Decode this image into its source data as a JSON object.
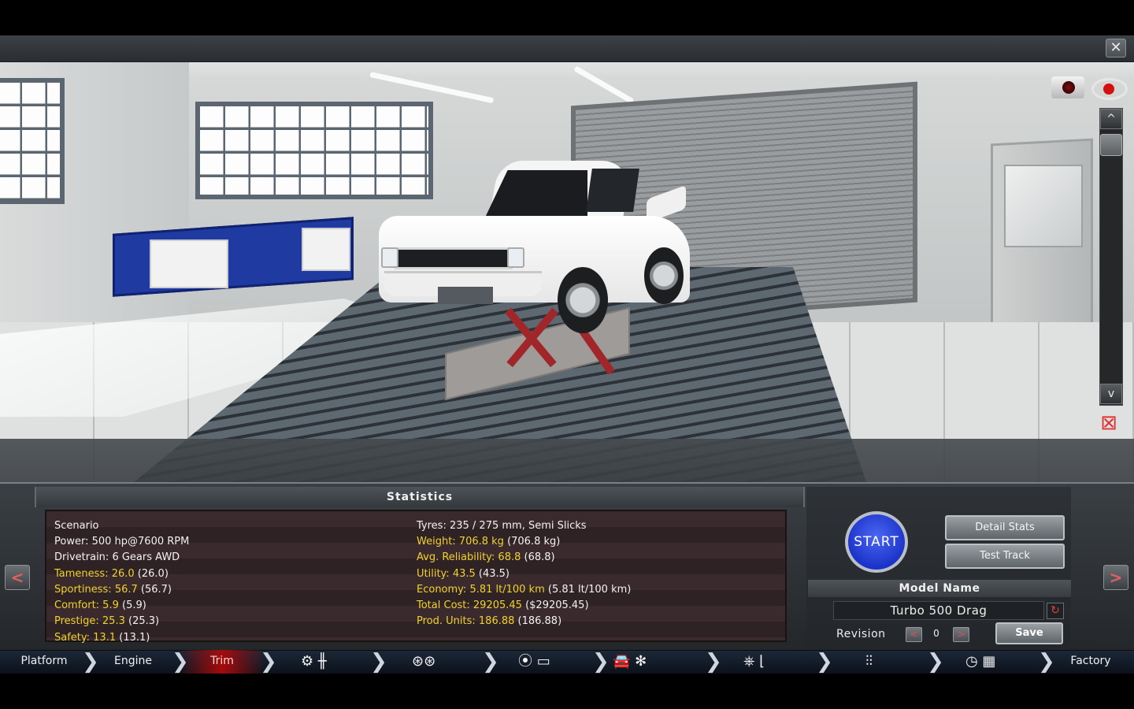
{
  "window": {
    "close_glyph": "✕"
  },
  "viewport": {
    "camera_icon": "camera-icon",
    "eye_icon": "eye-icon",
    "scroll_up": "^",
    "scroll_down": "v",
    "reset_glyph": "⊠"
  },
  "statistics": {
    "title": "Statistics",
    "left": [
      {
        "label": "Scenario",
        "value": "",
        "highlight": false
      },
      {
        "label": "Power:",
        "value": "500 hp@7600 RPM",
        "highlight": false
      },
      {
        "label": "Drivetrain:",
        "value": "6 Gears AWD",
        "highlight": false
      },
      {
        "label": "Tameness:",
        "value": "26.0",
        "paren": "(26.0)",
        "highlight": true
      },
      {
        "label": "Sportiness:",
        "value": "56.7",
        "paren": "(56.7)",
        "highlight": true
      },
      {
        "label": "Comfort:",
        "value": "5.9",
        "paren": "(5.9)",
        "highlight": true
      },
      {
        "label": "Prestige:",
        "value": "25.3",
        "paren": "(25.3)",
        "highlight": true
      },
      {
        "label": "Safety:",
        "value": "13.1",
        "paren": "(13.1)",
        "highlight": true
      }
    ],
    "right": [
      {
        "label": "Tyres:",
        "value": "235 / 275 mm, Semi Slicks",
        "highlight": false
      },
      {
        "label": "Weight:",
        "value": "706.8 kg",
        "paren": "(706.8 kg)",
        "highlight": true
      },
      {
        "label": "Avg. Reliability:",
        "value": "68.8",
        "paren": "(68.8)",
        "highlight": true
      },
      {
        "label": "Utility:",
        "value": "43.5",
        "paren": "(43.5)",
        "highlight": true
      },
      {
        "label": "Economy:",
        "value": "5.81 lt/100 km",
        "paren": "(5.81 lt/100 km)",
        "highlight": true
      },
      {
        "label": "Total Cost:",
        "value": "29205.45",
        "paren": "($29205.45)",
        "highlight": true
      },
      {
        "label": "Prod. Units:",
        "value": "186.88",
        "paren": "(186.88)",
        "highlight": true
      }
    ]
  },
  "controls": {
    "start_label": "START",
    "detail_stats_label": "Detail Stats",
    "test_track_label": "Test Track",
    "model_name_heading": "Model Name",
    "model_name_value": "Turbo 500 Drag",
    "revision_label": "Revision",
    "revision_value": "0",
    "rev_prev": "<",
    "rev_next": ">",
    "save_label": "Save",
    "prev_arrow": "<",
    "next_arrow": ">"
  },
  "nav": {
    "tabs": [
      {
        "label": "Platform",
        "active": false
      },
      {
        "label": "Engine",
        "active": false
      },
      {
        "label": "Trim",
        "active": true
      },
      {
        "label": "Factory",
        "active": false
      }
    ],
    "icon_groups": [
      {
        "name": "gearbox-icons",
        "glyph": "⚙ ╫"
      },
      {
        "name": "wheels-icons",
        "glyph": "⊛⊛"
      },
      {
        "name": "brakes-body-icons",
        "glyph": "⦿ ▭"
      },
      {
        "name": "body-aero-icons",
        "glyph": "🚘 ✻"
      },
      {
        "name": "interior-icons",
        "glyph": "⎈ ⌊"
      },
      {
        "name": "suspension-icons",
        "glyph": "⫶⫶"
      },
      {
        "name": "test-drive-icons",
        "glyph": "◷ ▦"
      }
    ]
  },
  "colors": {
    "accent_yellow": "#f0d230",
    "start_blue": "#2f47e0",
    "active_tab_red": "#a40b0b"
  }
}
